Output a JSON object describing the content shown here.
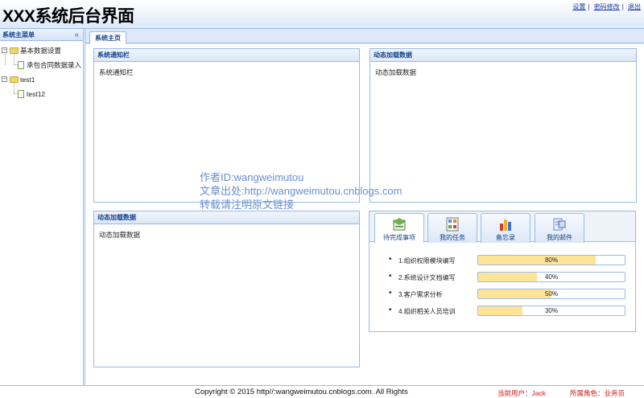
{
  "header": {
    "title": "XXX系统后台界面",
    "links": [
      "设置",
      "密码修改",
      "退出"
    ]
  },
  "sidebar": {
    "title": "系统主菜单",
    "collapse_glyph": "«",
    "tree": [
      {
        "label": "基本数据设置",
        "children": [
          {
            "label": "承包合同数据录入"
          }
        ]
      },
      {
        "label": "test1",
        "children": [
          {
            "label": "test12"
          }
        ]
      }
    ]
  },
  "main": {
    "tab": "系统主页",
    "portlets": [
      {
        "title": "系统通知栏",
        "body": "系统通知栏"
      },
      {
        "title": "动态加载数据",
        "body": "动态加载数据"
      },
      {
        "title": "动态加载数据",
        "body": "动态加载数据"
      }
    ],
    "tabpanel": {
      "tabs": [
        {
          "label": "待完成事项",
          "icon": "todo-icon",
          "active": true
        },
        {
          "label": "我的任务",
          "icon": "task-icon",
          "active": false
        },
        {
          "label": "备忘录",
          "icon": "memo-chart-icon",
          "active": false
        },
        {
          "label": "我的邮件",
          "icon": "mail-icon",
          "active": false
        }
      ],
      "tasks": [
        {
          "name": "1.组织权限模块编写",
          "progress": 80,
          "label": "80%"
        },
        {
          "name": "2.系统设计文档编写",
          "progress": 40,
          "label": "40%"
        },
        {
          "name": "3.客户需求分析",
          "progress": 50,
          "label": "50%"
        },
        {
          "name": "4.组织相关人员培训",
          "progress": 30,
          "label": "30%"
        }
      ]
    }
  },
  "watermark": {
    "lines": [
      "作者ID:wangweimutou",
      "文章出处:http://wangweimutou.cnblogs.com",
      "转载请注明原文链接"
    ]
  },
  "footer": {
    "copyright": "Copyright © 2015 http//:wangweimutou.cnblogs.com. All Rights",
    "user": "当前用户：Jack",
    "role": "所属角色：业务员"
  },
  "colors": {
    "border": "#99bbe8",
    "header_text": "#15428b",
    "progress_fill": "#ffe397",
    "footer_user": "#d21414",
    "watermark": "#6a8fd0"
  }
}
